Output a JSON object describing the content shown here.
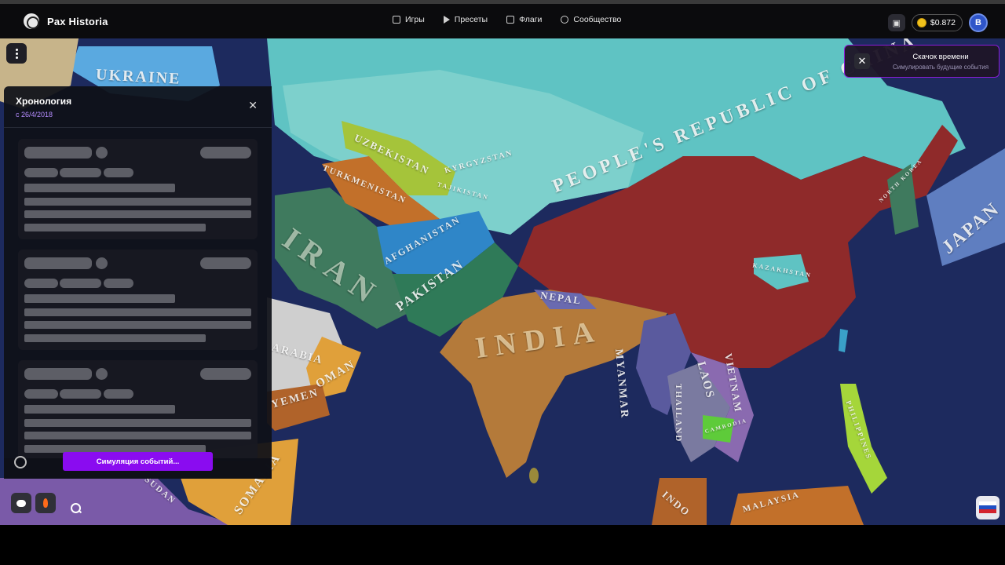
{
  "app": {
    "name": "Pax Historia"
  },
  "nav": [
    {
      "label": "Игры",
      "icon": "gamepad-icon"
    },
    {
      "label": "Пресеты",
      "icon": "play-icon"
    },
    {
      "label": "Флаги",
      "icon": "flag-icon"
    },
    {
      "label": "Сообщество",
      "icon": "users-icon"
    }
  ],
  "header_right": {
    "balance": "$0.872",
    "avatar_letter": "B"
  },
  "timeline": {
    "title": "Хронология",
    "since": "с 26/4/2018",
    "simulate_label": "Симуляция событий..."
  },
  "toast": {
    "title": "Скачок времени",
    "subtitle": "Симулировать будущие события"
  },
  "map_labels": {
    "ukraine": "UKRAINE",
    "uzbekistan": "UZBEKISTAN",
    "kyrgyzstan": "KYRGYZSTAN",
    "turkmenistan": "TURKMENISTAN",
    "tajikistan": "TAJIKISTAN",
    "afghanistan": "AFGHANISTAN",
    "iran": "IRAN",
    "pakistan": "PAKISTAN",
    "india": "INDIA",
    "nepal": "NEPAL",
    "china": "PEOPLE'S REPUBLIC OF CHINA",
    "kazakhstan_small": "KAZAKHSTAN",
    "myanmar": "MYANMAR",
    "laos": "LAOS",
    "vietnam": "VIETNAM",
    "thailand": "THAILAND",
    "cambodia": "CAMBODIA",
    "philippines": "PHILIPPINES",
    "japan": "JAPAN",
    "north_korea": "NORTH KOREA",
    "oman": "OMAN",
    "yemen": "YEMEN",
    "arabia": "ARABIA",
    "somalia": "SOMALIA",
    "sudan": "SUDAN",
    "malaysia": "MALAYSIA",
    "indonesia": "INDO"
  },
  "colors": {
    "accent": "#8a0cf0",
    "china": "#8f2a2a",
    "india": "#b47a3a",
    "russia": "#5fc3c3",
    "ocean": "#1d2a5e"
  }
}
